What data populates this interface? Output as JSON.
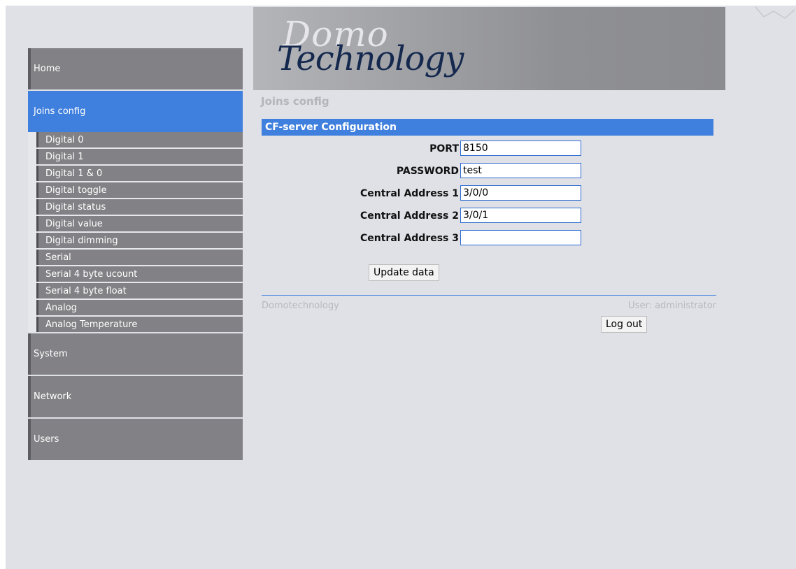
{
  "logo": {
    "part1": "Domo",
    "part2": "Technology"
  },
  "sidebar": {
    "items": [
      {
        "label": "Home"
      },
      {
        "label": "Joins config"
      },
      {
        "label": "System"
      },
      {
        "label": "Network"
      },
      {
        "label": "Users"
      }
    ],
    "submenu": [
      "Digital 0",
      "Digital 1",
      "Digital 1 & 0",
      "Digital toggle",
      "Digital status",
      "Digital value",
      "Digital dimming",
      "Serial",
      "Serial 4 byte ucount",
      "Serial 4 byte float",
      "Analog",
      "Analog Temperature"
    ]
  },
  "main": {
    "page_title": "Joins config",
    "section_title": "CF-server Configuration",
    "fields": [
      {
        "label": "PORT",
        "value": "8150"
      },
      {
        "label": "PASSWORD",
        "value": "test"
      },
      {
        "label": "Central Address 1",
        "value": "3/0/0"
      },
      {
        "label": "Central Address 2",
        "value": "3/0/1"
      },
      {
        "label": "Central Address 3",
        "value": ""
      }
    ],
    "update_button": "Update data"
  },
  "footer": {
    "brand": "Domotechnology",
    "user": "User: administrator",
    "logout_button": "Log out"
  },
  "colors": {
    "accent": "#3f7fdd",
    "menu_bg": "#828286",
    "page_bg": "#dfe1e6"
  }
}
